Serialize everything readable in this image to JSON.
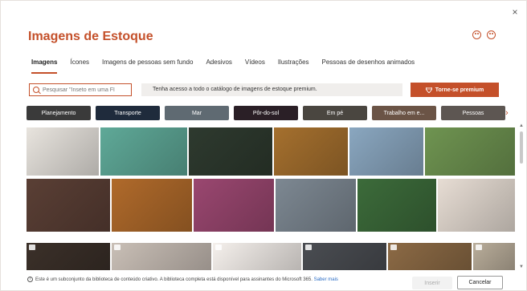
{
  "dialog": {
    "title": "Imagens de Estoque",
    "close_label": "×"
  },
  "tabs": [
    {
      "label": "Imagens",
      "active": true
    },
    {
      "label": "Ícones"
    },
    {
      "label": "Imagens de pessoas sem fundo"
    },
    {
      "label": "Adesivos"
    },
    {
      "label": "Vídeos"
    },
    {
      "label": "Ilustrações"
    },
    {
      "label": "Pessoas de desenhos animados"
    }
  ],
  "search": {
    "placeholder": "Pesquisar \"Inseto em uma Fl"
  },
  "promo": {
    "text": "Tenha acesso a todo o catálogo de imagens de estoque premium."
  },
  "premium_button": {
    "label": "Torne-se premium"
  },
  "chips": [
    {
      "label": "Planejamento",
      "color": "#3a3a3a"
    },
    {
      "label": "Transporte",
      "color": "#1f2b3c"
    },
    {
      "label": "Mar",
      "color": "#5f6a72"
    },
    {
      "label": "Pôr-do-sol",
      "color": "#2a1f26"
    },
    {
      "label": "Em pé",
      "color": "#4a4640"
    },
    {
      "label": "Trabalho em e...",
      "color": "#6b5446"
    },
    {
      "label": "Pessoas",
      "color": "#5d5652"
    }
  ],
  "chip_scroll_glyph": "›",
  "images": [
    {
      "name": "white-texture-image",
      "color": "#e8e4de"
    },
    {
      "name": "green-desk-stripes-image",
      "color": "#5fa998"
    },
    {
      "name": "dark-room-laptop-image",
      "color": "#2e3a2f"
    },
    {
      "name": "city-sunset-traffic-image",
      "color": "#a5702e"
    },
    {
      "name": "eagles-mountain-image",
      "color": "#8aa7c0"
    },
    {
      "name": "waterfall-landscape-image",
      "color": "#6f9451"
    },
    {
      "name": "night-lights-child-image",
      "color": "#5a3f35"
    },
    {
      "name": "building-facade-image",
      "color": "#b06a2b"
    },
    {
      "name": "hands-paint-colors-image",
      "color": "#9a4770"
    },
    {
      "name": "car-window-person-image",
      "color": "#7d8892"
    },
    {
      "name": "pink-flower-image",
      "color": "#3c6b3a"
    },
    {
      "name": "reaching-hands-image",
      "color": "#e7ddd4"
    },
    {
      "name": "sparkle-hands-image",
      "color": "#3b3029"
    },
    {
      "name": "bedroom-person-image",
      "color": "#c9bfb6"
    },
    {
      "name": "lipsticks-row-image",
      "color": "#f5f0ec"
    },
    {
      "name": "woman-smiling-image",
      "color": "#4a4d52"
    },
    {
      "name": "bread-baskets-image",
      "color": "#8c6a45"
    },
    {
      "name": "plant-pots-image",
      "color": "#b9ad9a"
    }
  ],
  "footer": {
    "info_text": "Este é um subconjunto da biblioteca de conteúdo criativo. A biblioteca completa está disponível para assinantes do Microsoft 365.",
    "learn_more": "Saber mais"
  },
  "buttons": {
    "insert": "Inserir",
    "cancel": "Cancelar"
  },
  "colors": {
    "accent": "#c4502a",
    "link": "#2b6cc4"
  }
}
